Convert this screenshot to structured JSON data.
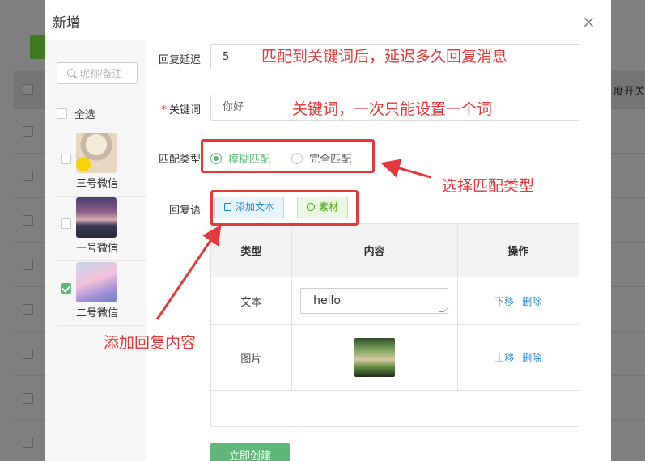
{
  "background": {
    "header_fragment": "度开关"
  },
  "modal": {
    "title": "新增",
    "close_glyph": "×"
  },
  "accounts": {
    "search_placeholder": "昵称/备注",
    "select_all_label": "全选",
    "items": [
      {
        "name": "三号微信",
        "checked": false
      },
      {
        "name": "一号微信",
        "checked": false
      },
      {
        "name": "二号微信",
        "checked": true
      }
    ]
  },
  "form": {
    "delay_label": "回复延迟",
    "delay_value": "5",
    "keyword_required_mark": "*",
    "keyword_label": "关键词",
    "keyword_value": "你好",
    "match_label": "匹配类型",
    "match_options": [
      {
        "label": "模糊匹配",
        "selected": true
      },
      {
        "label": "完全匹配",
        "selected": false
      }
    ],
    "reply_label": "回复语",
    "add_text_button": "添加文本",
    "material_button": "素材",
    "table": {
      "headers": [
        "类型",
        "内容",
        "操作"
      ],
      "rows": [
        {
          "type": "文本",
          "content": "hello",
          "actions": [
            "下移",
            "删除"
          ]
        },
        {
          "type": "图片",
          "content": "",
          "actions": [
            "上移",
            "删除"
          ]
        }
      ]
    },
    "submit_button": "立即创建"
  },
  "annotations": {
    "delay_note": "匹配到关键词后，延迟多久回复消息",
    "keyword_note": "关键词，一次只能设置一个词",
    "match_note": "选择匹配类型",
    "reply_note": "添加回复内容"
  },
  "colors": {
    "accent_green": "#5fb878",
    "link_blue": "#1e88d3",
    "annotation_red": "#e4393c"
  },
  "icons": [
    "search-icon",
    "close-icon",
    "file-text-icon",
    "image-material-icon",
    "resize-grip-icon"
  ]
}
